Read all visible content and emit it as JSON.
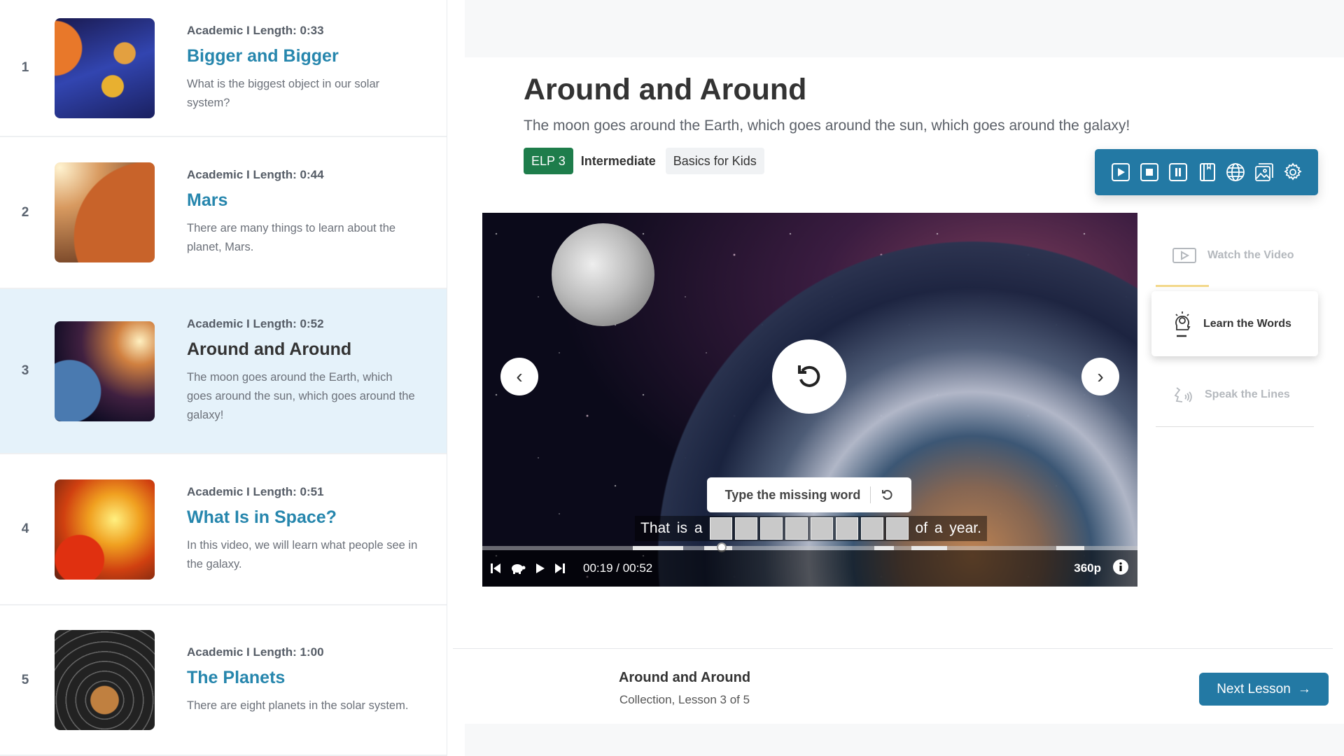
{
  "lessons": [
    {
      "num": "1",
      "meta": "Academic I Length: 0:33",
      "title": "Bigger and Bigger",
      "desc": "What is the biggest object in our solar system?"
    },
    {
      "num": "2",
      "meta": "Academic I Length: 0:44",
      "title": "Mars",
      "desc": "There are many things to learn about the planet, Mars."
    },
    {
      "num": "3",
      "meta": "Academic I Length: 0:52",
      "title": "Around and Around",
      "desc": "The moon goes around the Earth, which goes around the sun, which goes around the galaxy!"
    },
    {
      "num": "4",
      "meta": "Academic I Length: 0:51",
      "title": "What Is in Space?",
      "desc": "In this video, we will learn what people see in the galaxy."
    },
    {
      "num": "5",
      "meta": "Academic I Length: 1:00",
      "title": "The Planets",
      "desc": "There are eight planets in the solar system."
    }
  ],
  "selected_lesson": 3,
  "main": {
    "title": "Around and Around",
    "subtitle": "The moon goes around the Earth, which goes around the sun, which goes around the galaxy!",
    "elp": "ELP 3",
    "level": "Intermediate",
    "collection": "Basics for Kids"
  },
  "toolbar": [
    "play-icon",
    "stop-icon",
    "pause-icon",
    "notebook-icon",
    "globe-icon",
    "image-icon",
    "gear-icon"
  ],
  "video": {
    "tooltip": "Type the missing word",
    "caption_before": "That is a",
    "caption_after": "of a year.",
    "blank_letters": 8,
    "time": "00:19 / 00:52",
    "quality": "360p",
    "progress": 0.365
  },
  "steps": [
    {
      "label": "Watch the Video"
    },
    {
      "label": "Learn the Words"
    },
    {
      "label": "Speak the Lines"
    }
  ],
  "footer": {
    "title": "Around and Around",
    "subtitle": "Collection, Lesson 3 of 5",
    "next": "Next Lesson"
  },
  "colors": {
    "accent": "#2379a4",
    "link": "#2686ad",
    "elp": "#1e7d4b",
    "selected_bg": "#e5f2fa"
  }
}
